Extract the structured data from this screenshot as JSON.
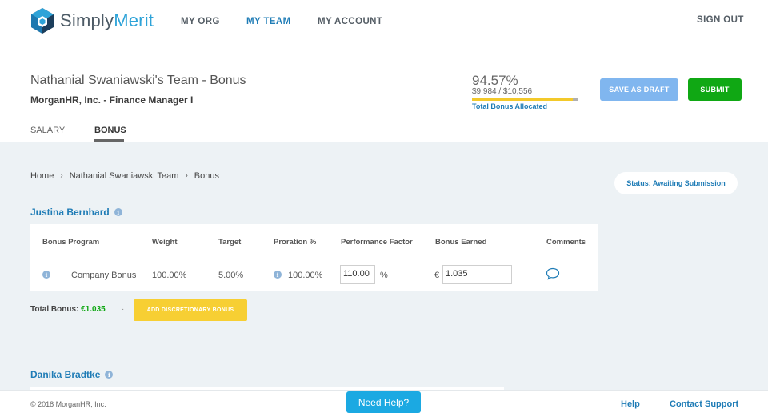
{
  "app": {
    "brand_part1": "Simply",
    "brand_part2": "Merit",
    "colors": {
      "primary": "#1f7cb6",
      "success": "#10a814",
      "warning": "#f7cf33",
      "draft": "#80b6ef",
      "background": "#edf2f5"
    }
  },
  "nav": {
    "items": [
      {
        "label": "MY ORG",
        "active": false
      },
      {
        "label": "MY TEAM",
        "active": true
      },
      {
        "label": "MY ACCOUNT",
        "active": false
      }
    ],
    "sign_out": "SIGN OUT"
  },
  "header": {
    "title": "Nathanial Swaniawski's Team - Bonus",
    "subtitle": "MorganHR, Inc. - Finance Manager I",
    "allocation": {
      "percent_text": "94.57%",
      "amount_text": "$9,984 / $10,556",
      "label": "Total Bonus Allocated",
      "fraction": 0.9457
    },
    "save_draft": "SAVE AS DRAFT",
    "submit": "SUBMIT",
    "tabs": [
      {
        "label": "SALARY",
        "active": false
      },
      {
        "label": "BONUS",
        "active": true
      }
    ]
  },
  "breadcrumb": {
    "items": [
      "Home",
      "Nathanial Swaniawski Team",
      "Bonus"
    ],
    "separator": "›"
  },
  "status": {
    "label": "Status: Awaiting Submission"
  },
  "employees": [
    {
      "name": "Justina Bernhard",
      "table": {
        "headers": [
          "Bonus Program",
          "Weight",
          "Target",
          "Proration %",
          "Performance Factor",
          "Bonus Earned",
          "Comments"
        ],
        "rows": [
          {
            "program": "Company Bonus",
            "weight": "100.00%",
            "target": "5.00%",
            "proration": "100.00%",
            "performance_factor": "110.00",
            "pf_unit": "%",
            "currency": "€",
            "bonus_earned": "1.035",
            "comment_icon": "comment-bubble-icon"
          }
        ]
      },
      "total_label": "Total Bonus:",
      "total_value": "€1.035",
      "add_discretionary": "ADD DISCRETIONARY BONUS"
    },
    {
      "name": "Danika Bradtke"
    }
  ],
  "info_icon_glyph": "i",
  "footer": {
    "copyright": "© 2018 MorganHR, Inc.",
    "need_help": "Need Help?",
    "help": "Help",
    "contact": "Contact Support"
  }
}
